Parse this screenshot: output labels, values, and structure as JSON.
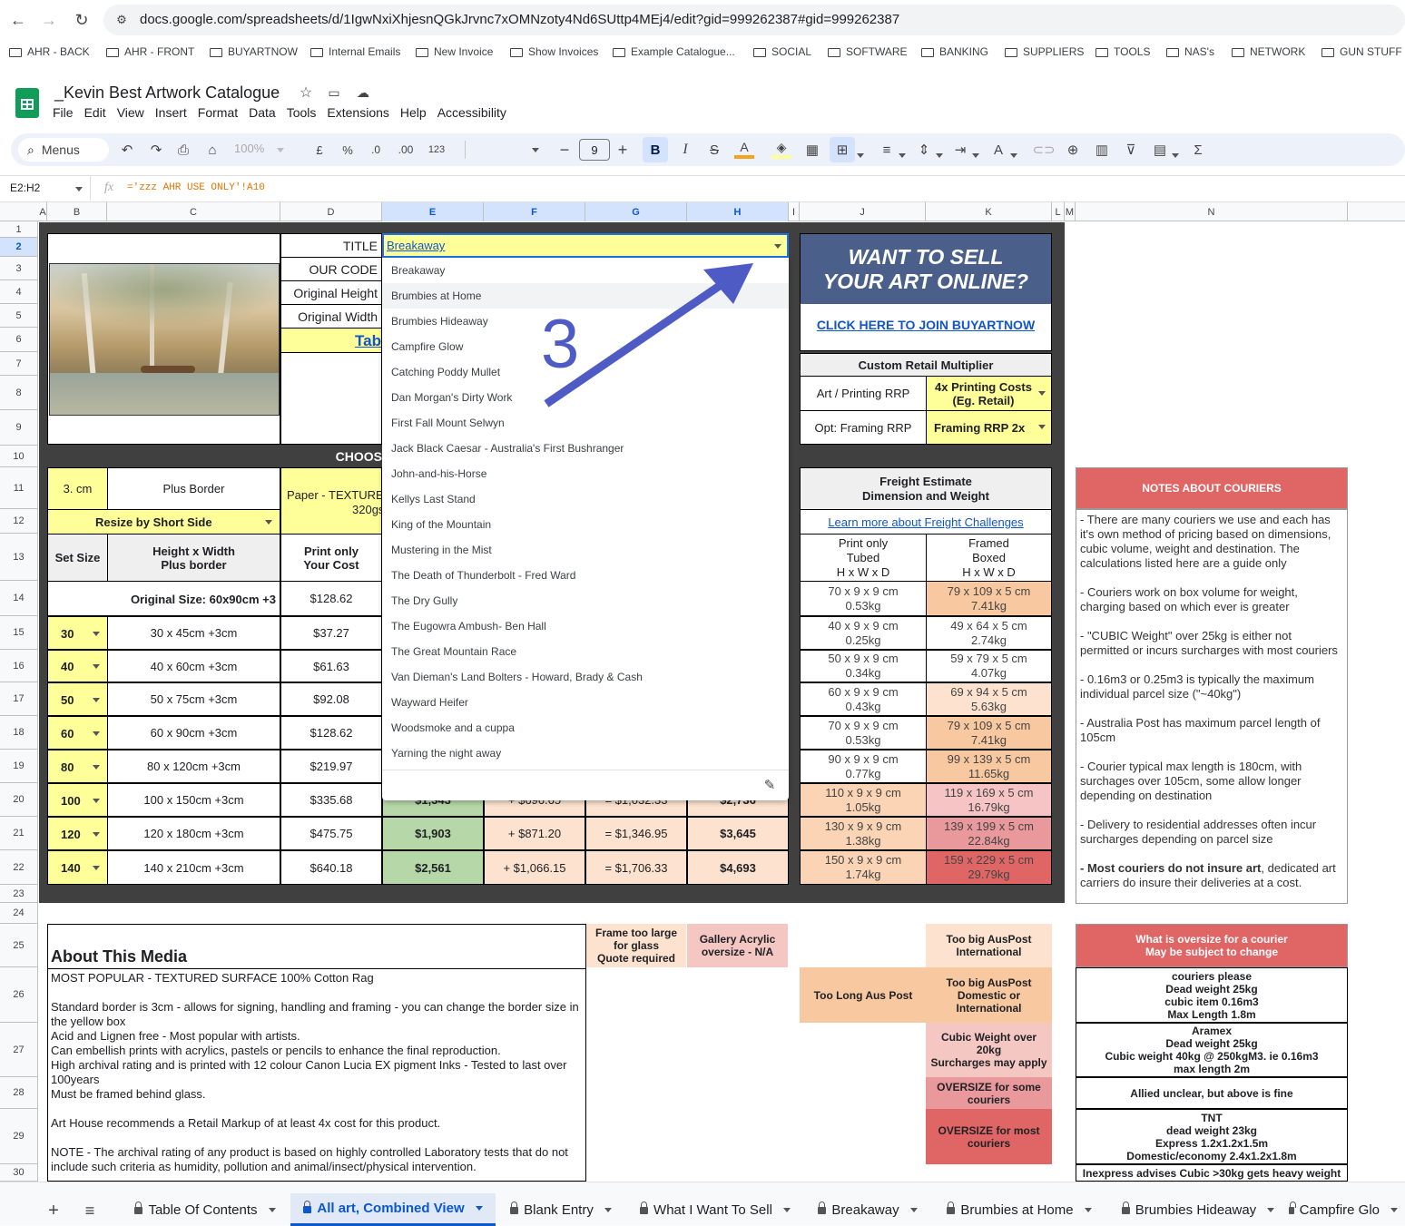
{
  "browser": {
    "url": "docs.google.com/spreadsheets/d/1IgwNxiXhjesnQGkJrvnc7xOMNzoty4Nd6SUttp4MEj4/edit?gid=999262387#gid=999262387",
    "bookmarks": [
      "AHR - BACK",
      "AHR - FRONT",
      "BUYARTNOW",
      "Internal Emails",
      "New Invoice",
      "Show Invoices",
      "Example Catalogue...",
      "SOCIAL",
      "SOFTWARE",
      "BANKING",
      "SUPPLIERS",
      "TOOLS",
      "NAS's",
      "NETWORK",
      "GUN STUFF"
    ]
  },
  "doc": {
    "title": "_Kevin Best Artwork Catalogue",
    "menu": [
      "File",
      "Edit",
      "View",
      "Insert",
      "Format",
      "Data",
      "Tools",
      "Extensions",
      "Help",
      "Accessibility"
    ]
  },
  "toolbar": {
    "menus": "Menus",
    "zoom": "100%",
    "currency": "£",
    "percent": "%",
    "dec_less": ".0",
    "dec_more": ".00",
    "num_format": "123",
    "font_size": "9",
    "bold": "B",
    "italic": "I"
  },
  "formula": {
    "name_box": "E2:H2",
    "fx": "fx",
    "formula": "='zzz AHR USE ONLY'!A10"
  },
  "columns": [
    "A",
    "B",
    "C",
    "D",
    "E",
    "F",
    "G",
    "H",
    "I",
    "J",
    "K",
    "L",
    "M",
    "N"
  ],
  "rows": [
    "1",
    "2",
    "3",
    "4",
    "5",
    "6",
    "7",
    "8",
    "9",
    "10",
    "11",
    "12",
    "13",
    "14",
    "15",
    "16",
    "17",
    "18",
    "19",
    "20",
    "21",
    "22",
    "23",
    "24",
    "25",
    "26",
    "27",
    "28",
    "29",
    "30"
  ],
  "sheet": {
    "labels": {
      "title": "TITLE",
      "our_code": "OUR CODE",
      "orig_height": "Original Height",
      "orig_width": "Original Width",
      "tab_link": "Tab",
      "choose": "CHOOS"
    },
    "title_value": "Breakaway",
    "border_size": "3. cm",
    "plus_border": "Plus Border",
    "paper_type": "Paper - TEXTURE",
    "paper_gsm": "320gs",
    "resize": "Resize by Short Side",
    "hdr_set_size": "Set Size",
    "hdr_hw": "Height x Width\nPlus border",
    "hdr_print": "Print only\nYour Cost",
    "original_size": "Original Size: 60x90cm +3",
    "original_cost": "$128.62",
    "size_rows": [
      {
        "set": "30",
        "hw": "30 x 45cm +3cm",
        "cost": "$37.27"
      },
      {
        "set": "40",
        "hw": "40 x 60cm +3cm",
        "cost": "$61.63"
      },
      {
        "set": "50",
        "hw": "50 x 75cm +3cm",
        "cost": "$92.08"
      },
      {
        "set": "60",
        "hw": "60 x 90cm +3cm",
        "cost": "$128.62"
      },
      {
        "set": "80",
        "hw": "80 x 120cm +3cm",
        "cost": "$219.97"
      },
      {
        "set": "100",
        "hw": "100 x 150cm +3cm",
        "cost": "$335.68"
      },
      {
        "set": "120",
        "hw": "120 x 180cm +3cm",
        "cost": "$475.75"
      },
      {
        "set": "140",
        "hw": "140 x 210cm +3cm",
        "cost": "$640.18"
      }
    ],
    "price_rows": [
      {
        "e": "$1,343",
        "f": "+ $696.65",
        "g": "= $1,032.33",
        "h": "$2,736"
      },
      {
        "e": "$1,903",
        "f": "+ $871.20",
        "g": "= $1,346.95",
        "h": "$3,645"
      },
      {
        "e": "$2,561",
        "f": "+ $1,066.15",
        "g": "= $1,706.33",
        "h": "$4,693"
      }
    ]
  },
  "dropdown": {
    "items": [
      "Breakaway",
      "Brumbies at Home",
      "Brumbies Hideaway",
      "Campfire Glow",
      "Catching Poddy Mullet",
      "Dan Morgan's Dirty Work",
      "First Fall Mount Selwyn",
      "Jack Black Caesar - Australia's First Bushranger",
      "John-and-his-Horse",
      "Kellys Last Stand",
      "King of the Mountain",
      "Mustering in the Mist",
      "The Death of Thunderbolt - Fred Ward",
      "The Dry Gully",
      "The Eugowra Ambush- Ben Hall",
      "The Great Mountain Race",
      "Van Dieman's Land Bolters - Howard, Brady & Cash",
      "Wayward Heifer",
      "Woodsmoke and a cuppa",
      "Yarning the night away"
    ],
    "hovered_index": 1
  },
  "annotation": {
    "number": "3"
  },
  "promo": {
    "line1": "WANT TO SELL",
    "line2": "YOUR ART ONLINE?",
    "link": "CLICK HERE TO JOIN BUYARTNOW"
  },
  "multiplier": {
    "title": "Custom Retail Multiplier",
    "art_label": "Art / Printing RRP",
    "art_value": "4x Printing Costs\n(Eg. Retail)",
    "frame_label": "Opt: Framing RRP",
    "frame_value": "Framing RRP 2x"
  },
  "freight": {
    "title": "Freight Estimate\nDimension and Weight",
    "link": "Learn more about Freight Challenges",
    "col1": "Print only\nTubed\nH x W x D",
    "col2": "Framed\nBoxed\nH x W x D",
    "rows": [
      {
        "tube": "70 x 9 x 9 cm\n0.53kg",
        "box": "79 x 109 x 5 cm\n7.41kg"
      },
      {
        "tube": "40 x 9 x 9 cm\n0.25kg",
        "box": "49 x 64 x 5 cm\n2.74kg"
      },
      {
        "tube": "50 x 9 x 9 cm\n0.34kg",
        "box": "59 x 79 x 5 cm\n4.07kg"
      },
      {
        "tube": "60 x 9 x 9 cm\n0.43kg",
        "box": "69 x 94 x 5 cm\n5.63kg"
      },
      {
        "tube": "70 x 9 x 9 cm\n0.53kg",
        "box": "79 x 109 x 5 cm\n7.41kg"
      },
      {
        "tube": "90 x 9 x 9 cm\n0.77kg",
        "box": "99 x 139 x 5 cm\n11.65kg"
      },
      {
        "tube": "110 x 9 x 9 cm\n1.05kg",
        "box": "119 x 169 x 5 cm\n16.79kg"
      },
      {
        "tube": "130 x 9 x 9 cm\n1.38kg",
        "box": "139 x 199 x 5 cm\n22.84kg"
      },
      {
        "tube": "150 x 9 x 9 cm\n1.74kg",
        "box": "159 x 229 x 5 cm\n29.79kg"
      }
    ]
  },
  "colors": {
    "tube": [
      "#fff",
      "#fff",
      "#fff",
      "#fff",
      "#fff",
      "#fff",
      "#fad4b4",
      "#fad4b4",
      "#fad4b4"
    ],
    "box": [
      "#f8c8a0",
      "#fff",
      "#fff",
      "#fde3cf",
      "#f8c8a0",
      "#f8c8a0",
      "#f6c4c4",
      "#e9999b",
      "#e06666"
    ]
  },
  "notes": {
    "title": "NOTES ABOUT COURIERS",
    "paras": [
      "- There are many couriers we use and each has it's own method of pricing based on dimensions, cubic volume, weight and destination. The calculations listed here are a guide only",
      "- Couriers work on box volume for weight, charging based on which ever is greater",
      "- \"CUBIC Weight\" over 25kg is either not permitted or incurs surcharges with most couriers",
      "- 0.16m3 or 0.25m3 is typically the maximum individual parcel size (\"~40kg\")",
      "- Australia Post has maximum parcel length of 105cm",
      "- Courier typical max length is 180cm, with surchages over 105cm, some allow longer depending on destination",
      "- Delivery to residential addresses often incur surcharges depending on parcel size"
    ],
    "last_bold": "- Most couriers do not insure art",
    "last_rest": ", dedicated art carriers do insure their deliveries at a cost."
  },
  "about": {
    "title": "About This Media",
    "lines": [
      "MOST POPULAR - TEXTURED SURFACE 100% Cotton Rag",
      "",
      "Standard border is 3cm - allows for signing, handling and framing - you can change the border size in the yellow box",
      "Acid and Lignen free - Most popular with artists.",
      "Can embellish prints with acrylics, pastels or pencils to enhance the final reproduction.",
      "High archival rating and is printed with 12 colour Canon Lucia EX pigment Inks - Tested to last over 100years",
      "Must be framed behind glass.",
      "",
      "Art House recommends a Retail Markup of at least 4x cost for this product.",
      "",
      "NOTE - The archival rating of any product is based on highly controlled Laboratory tests that do not include such criteria as humidity, pollution and animal/insect/physical intervention."
    ]
  },
  "legend": {
    "frame_glass": "Frame too large\nfor glass\nQuote required",
    "gallery": "Gallery Acrylic\noversize - N/A",
    "too_long": "Too Long Aus Post",
    "big_intl": "Too big AusPost\nInternational",
    "big_dom": "Too big AusPost\nDomestic or\nInternational",
    "cubic": "Cubic Weight over\n20kg\nSurcharges may apply",
    "over_some": "OVERSIZE for some\ncouriers",
    "over_most": "OVERSIZE for most\ncouriers"
  },
  "oversize": {
    "title": "What is oversize for a courier\nMay be subject to change",
    "rows": [
      "couriers please\nDead weight 25kg\ncubic item 0.16m3\nMax Length 1.8m",
      "Aramex\nDead weight 25kg\nCubic weight 40kg @ 250kgM3. ie 0.16m3\nmax length 2m",
      "Allied unclear, but above is fine",
      "TNT\ndead weight 23kg\nExpress 1.2x1.2x1.5m\nDomestic/economy 2.4x1.2x1.8m",
      "Inexpress advises Cubic >30kg gets heavy weight"
    ]
  },
  "tabs": [
    "Table Of Contents",
    "All art, Combined View",
    "Blank Entry",
    "What I Want To Sell",
    "Breakaway",
    "Brumbies at Home",
    "Brumbies Hideaway",
    "Campfire Glo"
  ]
}
